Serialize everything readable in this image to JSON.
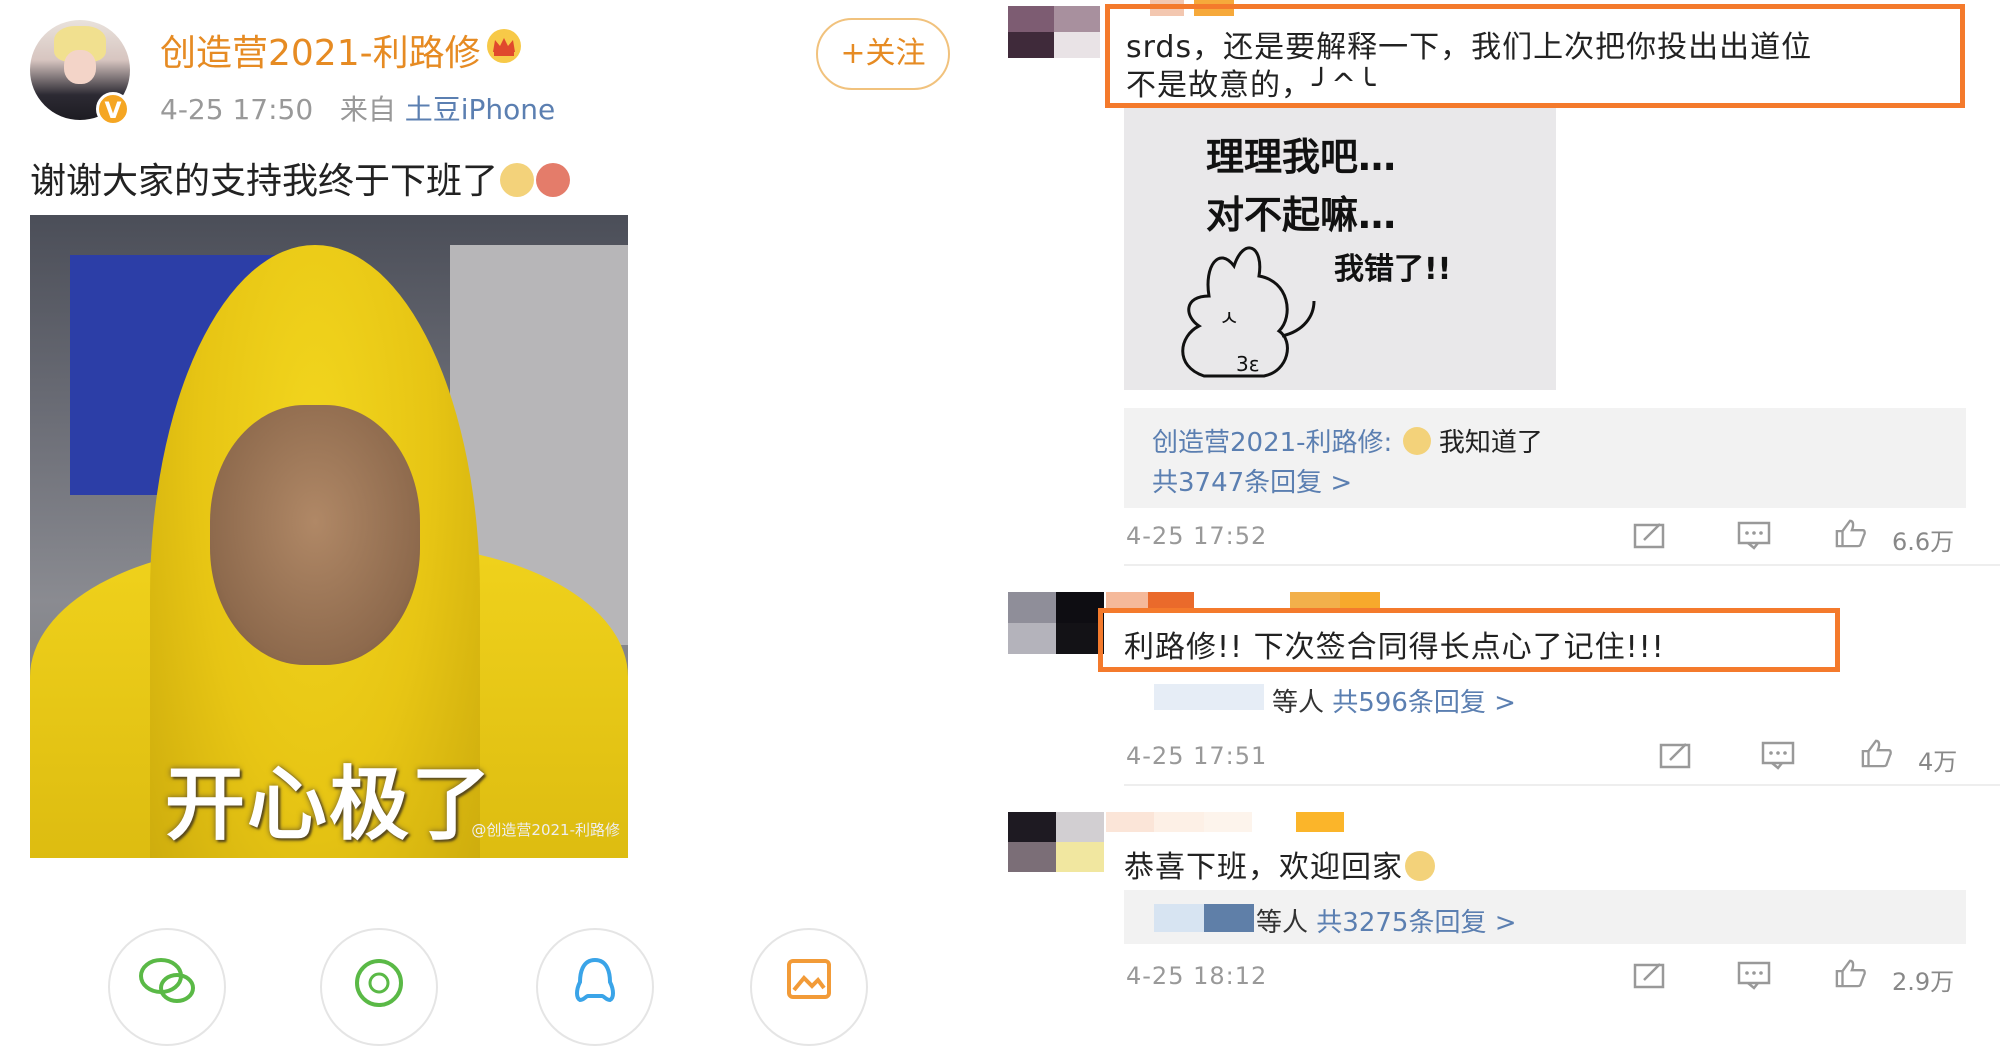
{
  "post": {
    "username": "创造营2021-利路修",
    "time": "4-25 17:50",
    "from_label": "来自",
    "source": "土豆iPhone",
    "follow_label": "+关注",
    "text": "谢谢大家的支持我终于下班了",
    "image_caption": "开心极了",
    "image_watermark": "@创造营2021-利路修"
  },
  "share_icons": [
    "wechat-icon",
    "moments-icon",
    "qq-icon",
    "album-icon"
  ],
  "comments": [
    {
      "text_line1": "srds，还是要解释一下，我们上次把你投出出道位",
      "text_line2": "不是故意的，╯^╰",
      "sticker_lines": [
        "理理我吧…",
        "对不起嘛…",
        "我错了!!"
      ],
      "reply_author": "创造营2021-利路修:",
      "reply_text": "我知道了",
      "reply_count": "共3747条回复 >",
      "time": "4-25 17:52",
      "likes": "6.6万"
    },
    {
      "text": "利路修!! 下次签合同得长点心了记住!!!",
      "reply_suffix": "等人",
      "reply_count": "共596条回复 >",
      "time": "4-25 17:51",
      "likes": "4万"
    },
    {
      "text": "恭喜下班，欢迎回家",
      "reply_suffix": "等人",
      "reply_count": "共3275条回复 >",
      "time": "4-25 18:12",
      "likes": "2.9万"
    }
  ],
  "colors": {
    "accent": "#e68b23",
    "link": "#5b7fb1",
    "highlight": "#f47a2c"
  }
}
